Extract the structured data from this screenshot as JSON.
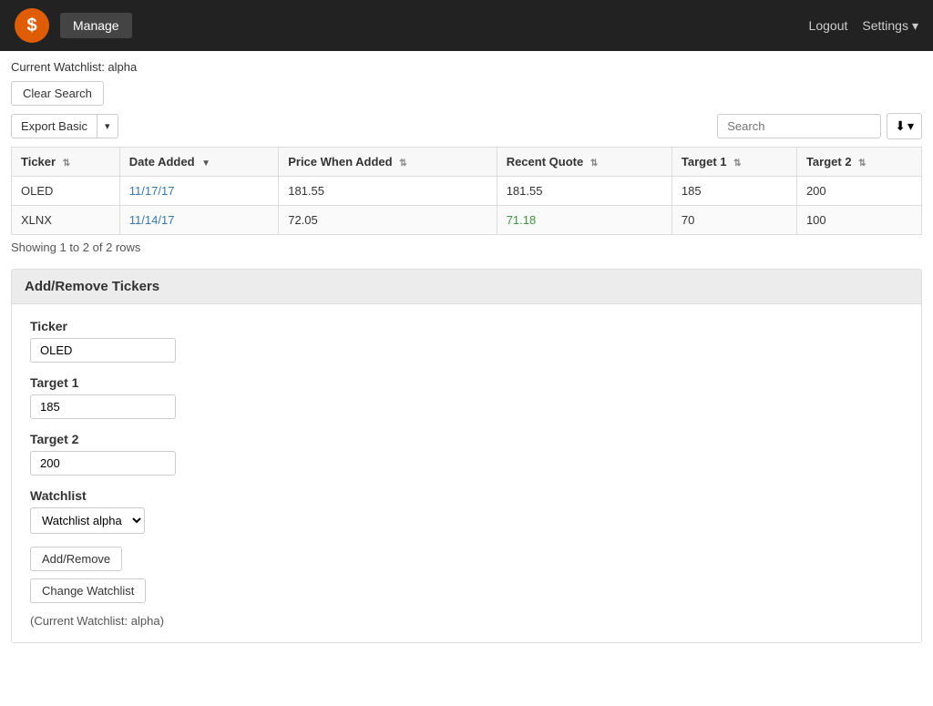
{
  "navbar": {
    "brand_icon": "$",
    "manage_label": "Manage",
    "logout_label": "Logout",
    "settings_label": "Settings"
  },
  "page": {
    "current_watchlist_text": "Current Watchlist: alpha"
  },
  "toolbar": {
    "clear_search_label": "Clear Search",
    "export_label": "Export Basic",
    "search_placeholder": "Search"
  },
  "table": {
    "columns": [
      {
        "key": "ticker",
        "label": "Ticker"
      },
      {
        "key": "date_added",
        "label": "Date Added"
      },
      {
        "key": "price_when_added",
        "label": "Price When Added"
      },
      {
        "key": "recent_quote",
        "label": "Recent Quote"
      },
      {
        "key": "target1",
        "label": "Target 1"
      },
      {
        "key": "target2",
        "label": "Target 2"
      }
    ],
    "rows": [
      {
        "ticker": "OLED",
        "date_added": "11/17/17",
        "price_when_added": "181.55",
        "recent_quote": "181.55",
        "recent_quote_color": "black",
        "target1": "185",
        "target2": "200"
      },
      {
        "ticker": "XLNX",
        "date_added": "11/14/17",
        "price_when_added": "72.05",
        "recent_quote": "71.18",
        "recent_quote_color": "green",
        "target1": "70",
        "target2": "100"
      }
    ],
    "row_count_text": "Showing 1 to 2 of 2 rows"
  },
  "add_remove": {
    "section_title": "Add/Remove Tickers",
    "ticker_label": "Ticker",
    "ticker_value": "OLED",
    "target1_label": "Target 1",
    "target1_value": "185",
    "target2_label": "Target 2",
    "target2_value": "200",
    "watchlist_label": "Watchlist",
    "watchlist_option": "Watchlist alpha",
    "add_remove_btn": "Add/Remove",
    "change_watchlist_btn": "Change Watchlist",
    "current_watchlist_note": "(Current Watchlist: alpha)"
  }
}
